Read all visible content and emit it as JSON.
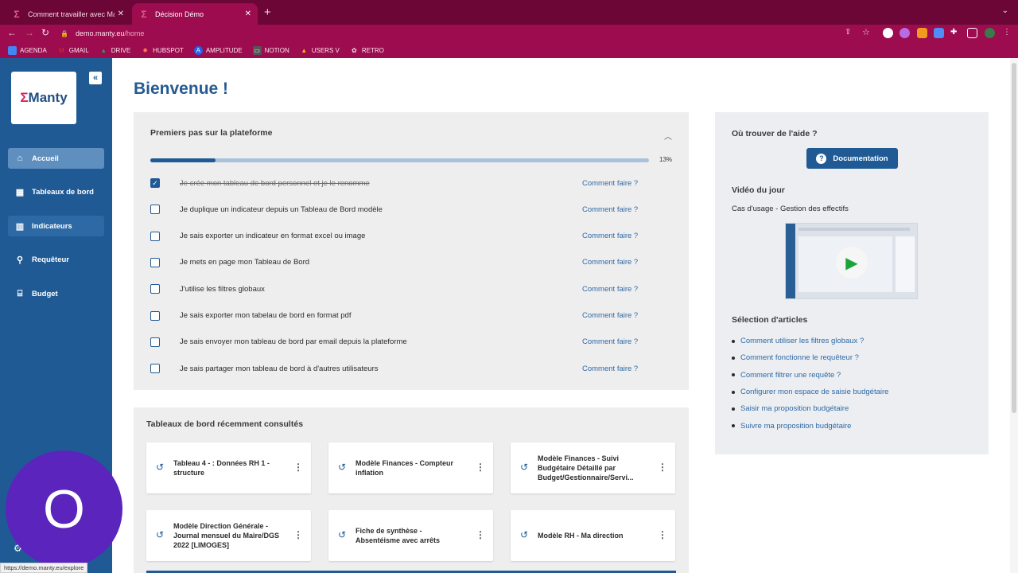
{
  "browser": {
    "tabs": [
      {
        "title": "Comment travailler avec Manty",
        "close": "✕"
      },
      {
        "title": "Décision Démo",
        "close": "✕"
      }
    ],
    "new_tab": "+",
    "url_host": "demo.manty.eu",
    "url_path": "/home",
    "bookmarks": [
      {
        "label": "AGENDA",
        "color": "#4285f4"
      },
      {
        "label": "GMAIL",
        "color": "#d93025"
      },
      {
        "label": "DRIVE",
        "color": "#1ea362"
      },
      {
        "label": "HUBSPOT",
        "color": "#ff7a59"
      },
      {
        "label": "AMPLITUDE",
        "color": "#1e61f0"
      },
      {
        "label": "NOTION",
        "color": "#222222"
      },
      {
        "label": "USERS V",
        "color": "#f2c200"
      },
      {
        "label": "RETRO",
        "color": "#888888"
      }
    ],
    "status_url": "https://demo.manty.eu/explore"
  },
  "sidebar": {
    "logo_sigma": "Σ",
    "logo_text": "Manty",
    "collapse_icon": "«",
    "items": [
      {
        "label": "Accueil",
        "icon": "⌂"
      },
      {
        "label": "Tableaux de bord",
        "icon": "▦"
      },
      {
        "label": "Indicateurs",
        "icon": "▥"
      },
      {
        "label": "Requêteur",
        "icon": "⚲"
      },
      {
        "label": "Budget",
        "icon": "⌸"
      }
    ],
    "avatar_initial": "O"
  },
  "main": {
    "title": "Bienvenue !",
    "onboarding": {
      "title": "Premiers pas sur la plateforme",
      "progress": 0.13,
      "progress_label": "13%",
      "tasks": [
        {
          "text": "Je crée mon tableau de bord personnel et je le renomme",
          "done": true,
          "link": "Comment faire ?"
        },
        {
          "text": "Je duplique un indicateur depuis un Tableau de Bord modèle",
          "done": false,
          "link": "Comment faire ?"
        },
        {
          "text": "Je sais exporter un indicateur en format excel ou image",
          "done": false,
          "link": "Comment faire ?"
        },
        {
          "text": "Je mets en page mon Tableau de Bord",
          "done": false,
          "link": "Comment faire ?"
        },
        {
          "text": "J'utilise les filtres globaux",
          "done": false,
          "link": "Comment faire ?"
        },
        {
          "text": "Je sais exporter mon tabelau de bord en format pdf",
          "done": false,
          "link": "Comment faire ?"
        },
        {
          "text": "Je sais envoyer mon tableau de bord par email depuis la plateforme",
          "done": false,
          "link": "Comment faire ?"
        },
        {
          "text": "Je sais partager mon tableau de bord à d'autres utilisateurs",
          "done": false,
          "link": "Comment faire ?"
        }
      ]
    },
    "recent": {
      "title": "Tableaux de bord récemment consultés",
      "tiles": [
        {
          "title": "Tableau 4 - : Données RH 1 - structure"
        },
        {
          "title": "Modèle Finances - Compteur inflation"
        },
        {
          "title": "Modèle Finances - Suivi Budgétaire Détaillé par Budget/Gestionnaire/Servi..."
        },
        {
          "title": "Modèle Direction Générale - Journal mensuel du Maire/DGS 2022 [LIMOGES]"
        },
        {
          "title": "Fiche de synthèse - Absentéisme avec arrêts"
        },
        {
          "title": "Modèle RH - Ma direction"
        }
      ]
    }
  },
  "help": {
    "title": "Où trouver de l'aide ?",
    "doc_button": "Documentation",
    "video_title": "Vidéo du jour",
    "video_subtitle": "Cas d'usage - Gestion des effectifs",
    "articles_title": "Sélection d'articles",
    "articles": [
      "Comment utiliser les filtres globaux ?",
      "Comment fonctionne le requêteur ?",
      "Comment filtrer une requête ?",
      "Configurer mon espace de saisie budgétaire",
      "Saisir ma proposition budgétaire",
      "Suivre ma proposition budgétaire"
    ]
  }
}
